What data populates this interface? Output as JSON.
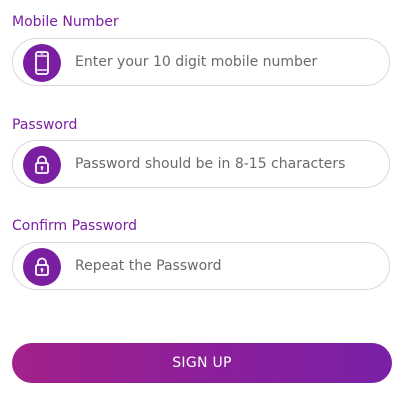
{
  "fields": [
    {
      "label": "Mobile Number",
      "placeholder": "Enter your 10 digit mobile number",
      "value": "",
      "icon": "mobile-phone-icon"
    },
    {
      "label": "Password",
      "placeholder": "Password should be in 8-15 characters",
      "value": "",
      "icon": "lock-icon"
    },
    {
      "label": "Confirm Password",
      "placeholder": "Repeat the Password",
      "value": "",
      "icon": "lock-icon"
    }
  ],
  "submit": {
    "label": "SIGN UP"
  },
  "colors": {
    "accent": "#7b1fa2",
    "button_gradient_start": "#a3218a",
    "button_gradient_end": "#7a20a6",
    "field_border": "#d9d9d9"
  }
}
